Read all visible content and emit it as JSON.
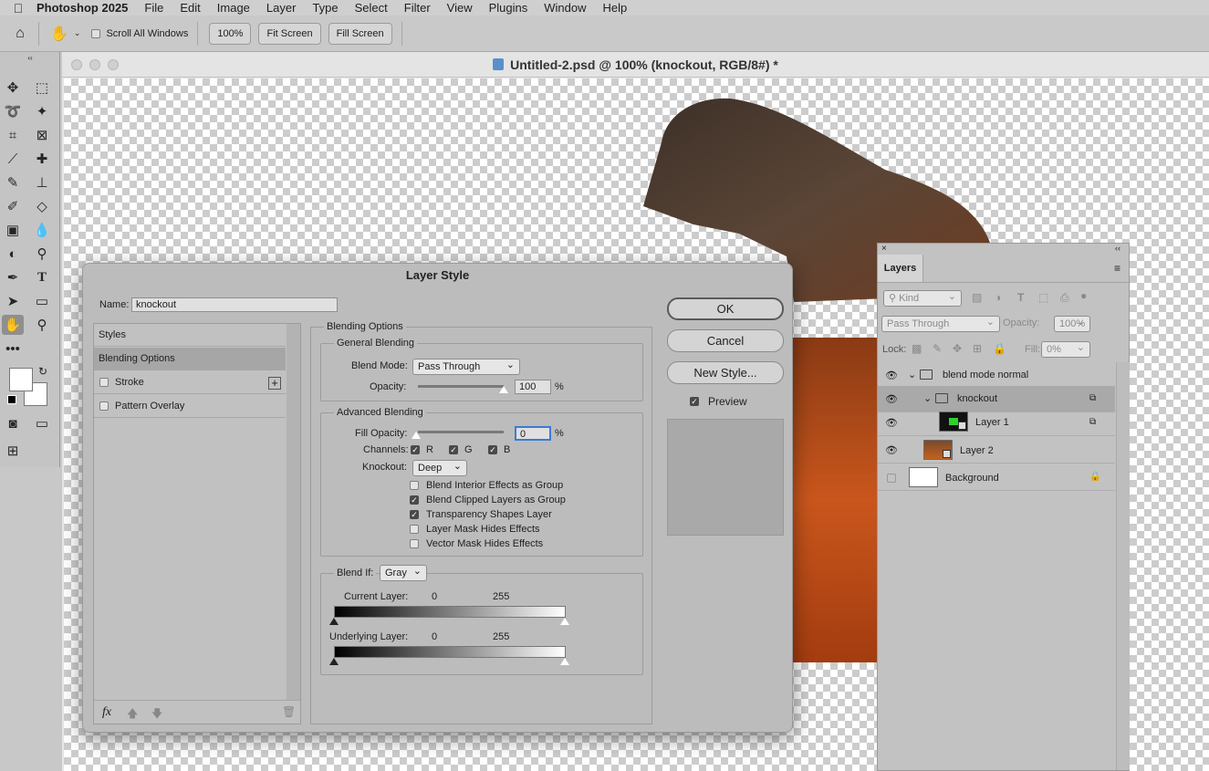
{
  "menubar": {
    "apple": "",
    "app": "Photoshop 2025",
    "items": [
      "File",
      "Edit",
      "Image",
      "Layer",
      "Type",
      "Select",
      "Filter",
      "View",
      "Plugins",
      "Window",
      "Help"
    ]
  },
  "options_bar": {
    "scroll_all_label": "Scroll All Windows",
    "zoom_100": "100%",
    "fit_screen": "Fit Screen",
    "fill_screen": "Fill Screen"
  },
  "document": {
    "title": "Untitled-2.psd @ 100% (knockout, RGB/8#) *"
  },
  "dialog": {
    "title": "Layer Style",
    "name_label": "Name:",
    "name_value": "knockout",
    "styles_list": [
      "Styles",
      "Blending Options",
      "Stroke",
      "Pattern Overlay"
    ],
    "blending_options_title": "Blending Options",
    "general_blending_title": "General Blending",
    "blend_mode_label": "Blend Mode:",
    "blend_mode_value": "Pass Through",
    "opacity_label": "Opacity:",
    "opacity_value": "100",
    "opacity_unit": "%",
    "advanced_blending_title": "Advanced Blending",
    "fill_opacity_label": "Fill Opacity:",
    "fill_opacity_value": "0",
    "fill_opacity_unit": "%",
    "channels_label": "Channels:",
    "channels": [
      "R",
      "G",
      "B"
    ],
    "knockout_label": "Knockout:",
    "knockout_value": "Deep",
    "options": [
      {
        "label": "Blend Interior Effects as Group",
        "checked": false
      },
      {
        "label": "Blend Clipped Layers as Group",
        "checked": true
      },
      {
        "label": "Transparency Shapes Layer",
        "checked": true
      },
      {
        "label": "Layer Mask Hides Effects",
        "checked": false
      },
      {
        "label": "Vector Mask Hides Effects",
        "checked": false
      }
    ],
    "blend_if_label": "Blend If:",
    "blend_if_value": "Gray",
    "current_layer_label": "Current Layer:",
    "current_layer_min": "0",
    "current_layer_max": "255",
    "underlying_layer_label": "Underlying Layer:",
    "underlying_layer_min": "0",
    "underlying_layer_max": "255",
    "ok": "OK",
    "cancel": "Cancel",
    "new_style": "New Style...",
    "preview_label": "Preview",
    "fx_label": "fx"
  },
  "layers_panel": {
    "tab": "Layers",
    "kind_label": "Kind",
    "blend_mode": "Pass Through",
    "opacity_label": "Opacity:",
    "opacity_value": "100%",
    "lock_label": "Lock:",
    "fill_label": "Fill:",
    "fill_value": "0%",
    "layers": [
      {
        "name": "blend mode normal",
        "type": "group"
      },
      {
        "name": "knockout",
        "type": "group"
      },
      {
        "name": "Layer 1",
        "type": "layer"
      },
      {
        "name": "Layer 2",
        "type": "layer"
      },
      {
        "name": "Background",
        "type": "background"
      }
    ]
  },
  "colors": {
    "accent_focus": "#3b7bd6",
    "wood_dark": "#4a3a2e",
    "wood_orange": "#c4501a"
  }
}
